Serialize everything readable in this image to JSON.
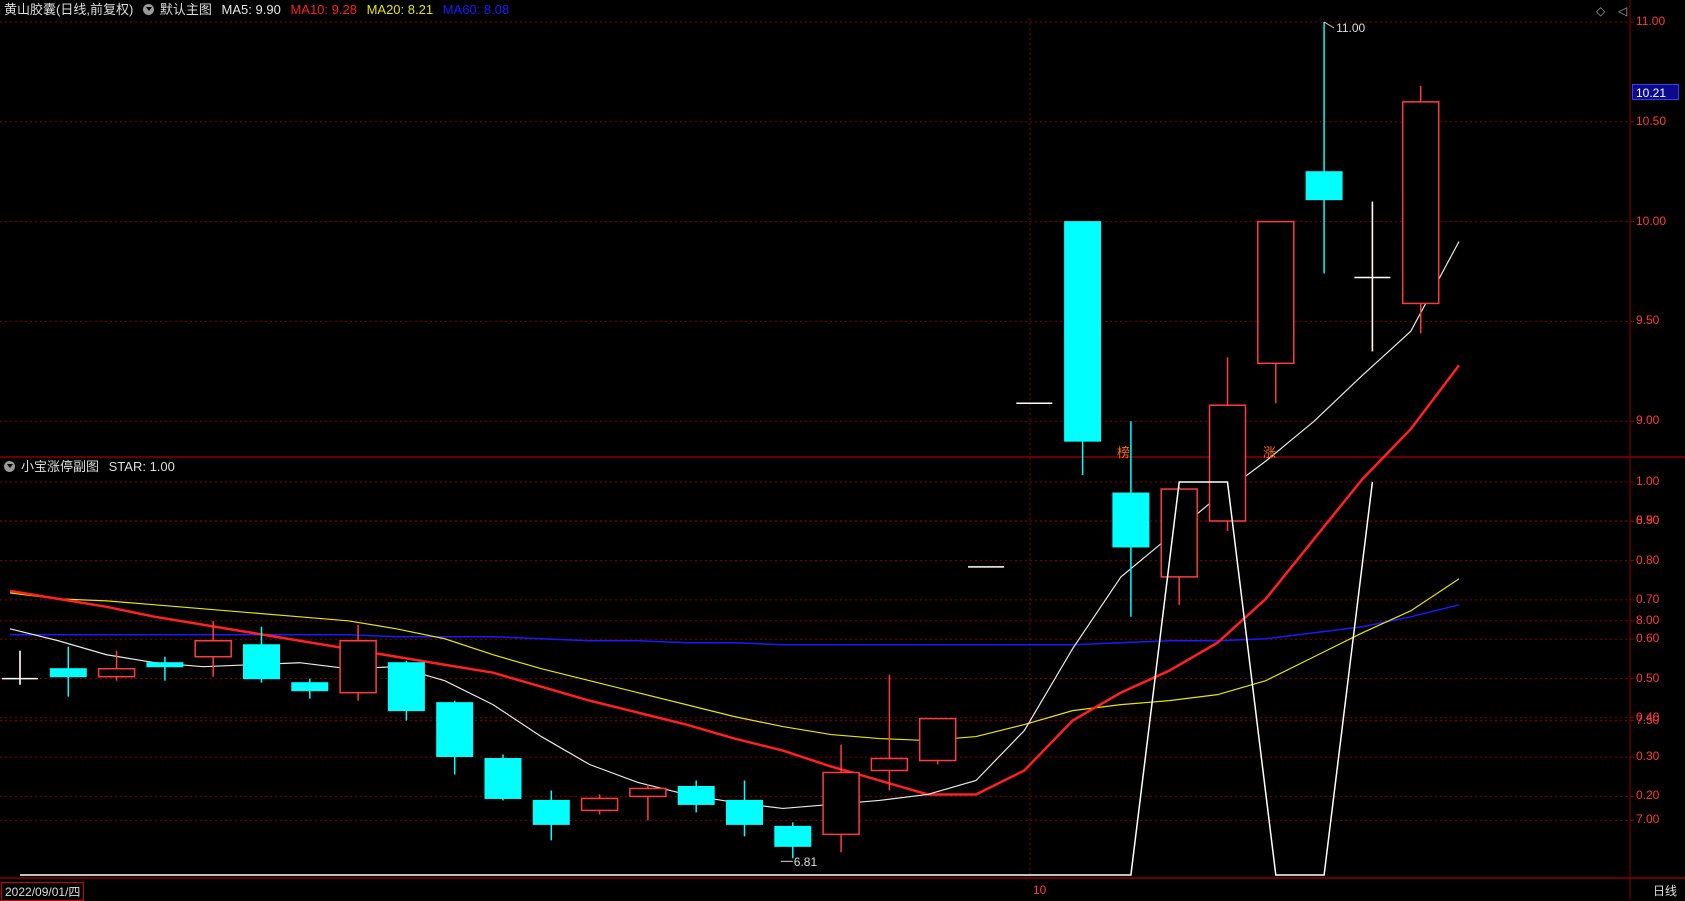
{
  "header": {
    "stock_name": "黄山胶囊(日线,前复权)",
    "main_title": "默认主图",
    "ma5": "MA5: 9.90",
    "ma10": "MA10: 9.28",
    "ma20": "MA20: 8.21",
    "ma60": "MA60: 8.08"
  },
  "sub_header": {
    "title": "小宝涨停副图",
    "star": "STAR: 1.00"
  },
  "current_price": "10.21",
  "date_label": "2022/09/01/四",
  "month_label": "10",
  "period_label": "日线",
  "high_label": "11.00",
  "low_label": "6.81",
  "tags": {
    "bang": "榜",
    "zhang": "涨"
  },
  "colors": {
    "up": "#ff3c3c",
    "down": "#00ffff",
    "ma5": "#e8e8e8",
    "ma10": "#ff2020",
    "ma20": "#e6e600",
    "ma60": "#1a1aff",
    "grid": "#8a0000",
    "star": "#ffffff"
  },
  "chart_data": [
    {
      "type": "candlestick",
      "title": "默认主图",
      "ylim": [
        6.7,
        11.05
      ],
      "yticks": [
        "11.00",
        "10.50",
        "10.00",
        "9.50",
        "9.00",
        "8.50",
        "8.00",
        "7.50",
        "7.00"
      ],
      "candles": [
        {
          "o": 7.71,
          "c": 7.71,
          "h": 7.85,
          "l": 7.68
        },
        {
          "o": 7.76,
          "c": 7.72,
          "h": 7.87,
          "l": 7.62
        },
        {
          "o": 7.72,
          "c": 7.76,
          "h": 7.85,
          "l": 7.7
        },
        {
          "o": 7.79,
          "c": 7.77,
          "h": 7.82,
          "l": 7.7
        },
        {
          "o": 7.82,
          "c": 7.9,
          "h": 8.0,
          "l": 7.72
        },
        {
          "o": 7.88,
          "c": 7.71,
          "h": 7.97,
          "l": 7.69
        },
        {
          "o": 7.69,
          "c": 7.65,
          "h": 7.71,
          "l": 7.61
        },
        {
          "o": 7.64,
          "c": 7.9,
          "h": 7.98,
          "l": 7.6
        },
        {
          "o": 7.79,
          "c": 7.55,
          "h": 7.8,
          "l": 7.5
        },
        {
          "o": 7.59,
          "c": 7.32,
          "h": 7.6,
          "l": 7.23
        },
        {
          "o": 7.31,
          "c": 7.11,
          "h": 7.33,
          "l": 7.1
        },
        {
          "o": 7.1,
          "c": 6.98,
          "h": 7.15,
          "l": 6.9
        },
        {
          "o": 7.05,
          "c": 7.11,
          "h": 7.13,
          "l": 7.03
        },
        {
          "o": 7.12,
          "c": 7.16,
          "h": 7.18,
          "l": 7.0
        },
        {
          "o": 7.17,
          "c": 7.08,
          "h": 7.2,
          "l": 7.04
        },
        {
          "o": 7.1,
          "c": 6.98,
          "h": 7.2,
          "l": 6.92
        },
        {
          "o": 6.97,
          "c": 6.87,
          "h": 6.99,
          "l": 6.81
        },
        {
          "o": 6.93,
          "c": 7.24,
          "h": 7.38,
          "l": 6.84
        },
        {
          "o": 7.25,
          "c": 7.31,
          "h": 7.73,
          "l": 7.15
        },
        {
          "o": 7.3,
          "c": 7.51,
          "h": 7.51,
          "l": 7.28
        },
        {
          "o": 8.27,
          "c": 8.27,
          "h": 8.27,
          "l": 8.27
        },
        {
          "o": 9.09,
          "c": 9.09,
          "h": 9.09,
          "l": 9.09
        },
        {
          "o": 10.0,
          "c": 8.9,
          "h": 10.0,
          "l": 8.73
        },
        {
          "o": 8.64,
          "c": 8.37,
          "h": 9.0,
          "l": 8.02
        },
        {
          "o": 8.22,
          "c": 8.66,
          "h": 8.67,
          "l": 8.08
        },
        {
          "o": 8.5,
          "c": 9.08,
          "h": 9.32,
          "l": 8.45
        },
        {
          "o": 9.29,
          "c": 10.0,
          "h": 10.0,
          "l": 9.09
        },
        {
          "o": 10.25,
          "c": 10.11,
          "h": 11.0,
          "l": 9.74
        },
        {
          "o": 9.72,
          "c": 9.72,
          "h": 10.1,
          "l": 9.35
        },
        {
          "o": 9.59,
          "c": 10.6,
          "h": 10.68,
          "l": 9.44
        }
      ],
      "ma5": [
        7.96,
        7.9,
        7.83,
        7.79,
        7.77,
        7.78,
        7.79,
        7.76,
        7.77,
        7.7,
        7.58,
        7.42,
        7.28,
        7.19,
        7.13,
        7.09,
        7.06,
        7.08,
        7.1,
        7.13,
        7.2,
        7.45,
        7.86,
        8.22,
        8.42,
        8.62,
        8.8,
        9.0,
        9.23,
        9.45,
        9.9
      ],
      "ma10": [
        8.15,
        8.11,
        8.07,
        8.02,
        7.98,
        7.94,
        7.9,
        7.86,
        7.82,
        7.78,
        7.74,
        7.67,
        7.6,
        7.54,
        7.48,
        7.41,
        7.35,
        7.27,
        7.2,
        7.13,
        7.13,
        7.25,
        7.5,
        7.64,
        7.75,
        7.89,
        8.11,
        8.41,
        8.71,
        8.96,
        9.28
      ],
      "ma20": [
        8.14,
        8.11,
        8.1,
        8.08,
        8.06,
        8.04,
        8.02,
        8.0,
        7.96,
        7.91,
        7.83,
        7.76,
        7.7,
        7.64,
        7.58,
        7.52,
        7.47,
        7.43,
        7.41,
        7.4,
        7.42,
        7.48,
        7.55,
        7.58,
        7.6,
        7.63,
        7.7,
        7.82,
        7.94,
        8.05,
        8.21
      ],
      "ma60": [
        7.93,
        7.93,
        7.93,
        7.93,
        7.93,
        7.93,
        7.93,
        7.93,
        7.92,
        7.92,
        7.92,
        7.91,
        7.9,
        7.9,
        7.89,
        7.89,
        7.88,
        7.88,
        7.88,
        7.88,
        7.88,
        7.88,
        7.88,
        7.89,
        7.9,
        7.9,
        7.91,
        7.94,
        7.97,
        8.02,
        8.08
      ]
    },
    {
      "type": "line",
      "title": "小宝涨停副图",
      "series": [
        {
          "name": "STAR",
          "values": [
            0,
            0,
            0,
            0,
            0,
            0,
            0,
            0,
            0,
            0,
            0,
            0,
            0,
            0,
            0,
            0,
            0,
            0,
            0,
            0,
            0,
            0,
            0,
            0,
            1,
            1,
            0,
            0,
            1
          ]
        }
      ],
      "ylim": [
        -0.05,
        1.0
      ],
      "yticks": [
        "1.00",
        "0.90",
        "0.80",
        "0.70",
        "0.60",
        "0.50",
        "0.40",
        "0.30",
        "0.20"
      ]
    }
  ]
}
